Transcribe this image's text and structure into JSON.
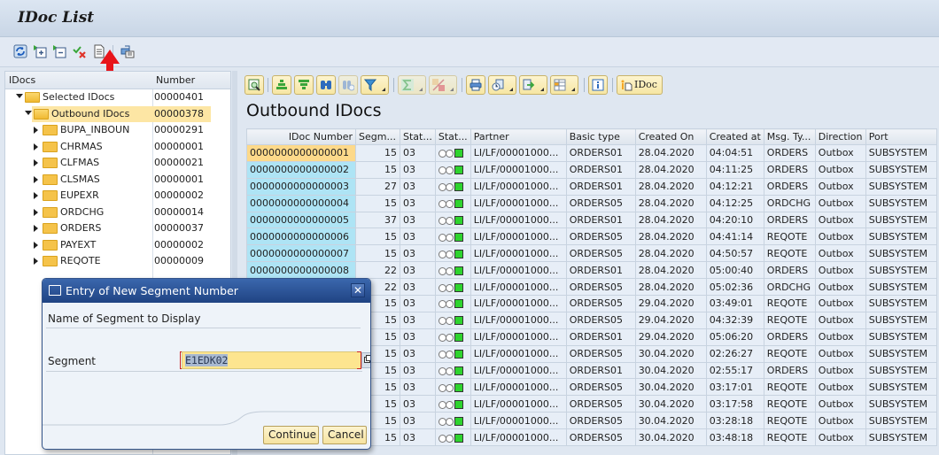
{
  "window": {
    "title": "IDoc List"
  },
  "app_toolbar": {
    "icons": [
      "refresh-icon",
      "expand-subtree-icon",
      "collapse-subtree-icon",
      "check-cancel-icon",
      "document-icon",
      "transport-icon"
    ]
  },
  "annotation": {
    "arrow_color": "#e8141a",
    "points_to": "document-icon"
  },
  "tree": {
    "columns": [
      "IDocs",
      "Number"
    ],
    "nodes": [
      {
        "label": "Selected IDocs",
        "number": "00000401",
        "level": 0,
        "expanded": true
      },
      {
        "label": "Outbound IDocs",
        "number": "00000378",
        "level": 1,
        "expanded": true,
        "selected": true
      },
      {
        "label": "BUPA_INBOUN",
        "number": "00000291",
        "level": 2
      },
      {
        "label": "CHRMAS",
        "number": "00000001",
        "level": 2
      },
      {
        "label": "CLFMAS",
        "number": "00000021",
        "level": 2
      },
      {
        "label": "CLSMAS",
        "number": "00000001",
        "level": 2
      },
      {
        "label": "EUPEXR",
        "number": "00000002",
        "level": 2
      },
      {
        "label": "ORDCHG",
        "number": "00000014",
        "level": 2
      },
      {
        "label": "ORDERS",
        "number": "00000037",
        "level": 2
      },
      {
        "label": "PAYEXT",
        "number": "00000002",
        "level": 2
      },
      {
        "label": "REQOTE",
        "number": "00000009",
        "level": 2
      }
    ]
  },
  "alv_toolbar": {
    "idoc_button_label": "IDoc",
    "buttons": [
      "details-icon",
      "sort-ascending-icon",
      "sort-descending-icon",
      "find-icon",
      "find-next-icon",
      "filter-icon",
      "sum-icon",
      "subtotal-icon",
      "print-icon",
      "views-icon",
      "export-icon",
      "layout-icon",
      "info-icon",
      "idoc-icon"
    ]
  },
  "grid": {
    "title": "Outbound IDocs",
    "columns": [
      "IDoc Number",
      "Segm...",
      "Stat...",
      "Stat...",
      "Partner",
      "Basic type",
      "Created On",
      "Created at",
      "Msg. Ty...",
      "Direction",
      "Port"
    ],
    "rows": [
      [
        "0000000000000001",
        "15",
        "03",
        "green",
        "LI/LF/00001000...",
        "ORDERS01",
        "28.04.2020",
        "04:04:51",
        "ORDERS",
        "Outbox",
        "SUBSYSTEM"
      ],
      [
        "0000000000000002",
        "15",
        "03",
        "green",
        "LI/LF/00001000...",
        "ORDERS01",
        "28.04.2020",
        "04:11:25",
        "ORDERS",
        "Outbox",
        "SUBSYSTEM"
      ],
      [
        "0000000000000003",
        "27",
        "03",
        "green",
        "LI/LF/00001000...",
        "ORDERS01",
        "28.04.2020",
        "04:12:21",
        "ORDERS",
        "Outbox",
        "SUBSYSTEM"
      ],
      [
        "0000000000000004",
        "15",
        "03",
        "green",
        "LI/LF/00001000...",
        "ORDERS05",
        "28.04.2020",
        "04:12:25",
        "ORDCHG",
        "Outbox",
        "SUBSYSTEM"
      ],
      [
        "0000000000000005",
        "37",
        "03",
        "green",
        "LI/LF/00001000...",
        "ORDERS01",
        "28.04.2020",
        "04:20:10",
        "ORDERS",
        "Outbox",
        "SUBSYSTEM"
      ],
      [
        "0000000000000006",
        "15",
        "03",
        "green",
        "LI/LF/00001000...",
        "ORDERS05",
        "28.04.2020",
        "04:41:14",
        "REQOTE",
        "Outbox",
        "SUBSYSTEM"
      ],
      [
        "0000000000000007",
        "15",
        "03",
        "green",
        "LI/LF/00001000...",
        "ORDERS05",
        "28.04.2020",
        "04:50:57",
        "REQOTE",
        "Outbox",
        "SUBSYSTEM"
      ],
      [
        "0000000000000008",
        "22",
        "03",
        "green",
        "LI/LF/00001000...",
        "ORDERS01",
        "28.04.2020",
        "05:00:40",
        "ORDERS",
        "Outbox",
        "SUBSYSTEM"
      ],
      [
        "",
        "22",
        "03",
        "green",
        "LI/LF/00001000...",
        "ORDERS05",
        "28.04.2020",
        "05:02:36",
        "ORDCHG",
        "Outbox",
        "SUBSYSTEM"
      ],
      [
        "",
        "15",
        "03",
        "green",
        "LI/LF/00001000...",
        "ORDERS05",
        "29.04.2020",
        "03:49:01",
        "REQOTE",
        "Outbox",
        "SUBSYSTEM"
      ],
      [
        "",
        "15",
        "03",
        "green",
        "LI/LF/00001000...",
        "ORDERS05",
        "29.04.2020",
        "04:32:39",
        "REQOTE",
        "Outbox",
        "SUBSYSTEM"
      ],
      [
        "",
        "15",
        "03",
        "green",
        "LI/LF/00001000...",
        "ORDERS01",
        "29.04.2020",
        "05:06:20",
        "ORDERS",
        "Outbox",
        "SUBSYSTEM"
      ],
      [
        "",
        "15",
        "03",
        "green",
        "LI/LF/00001000...",
        "ORDERS05",
        "30.04.2020",
        "02:26:27",
        "REQOTE",
        "Outbox",
        "SUBSYSTEM"
      ],
      [
        "",
        "15",
        "03",
        "green",
        "LI/LF/00001000...",
        "ORDERS01",
        "30.04.2020",
        "02:55:17",
        "ORDERS",
        "Outbox",
        "SUBSYSTEM"
      ],
      [
        "",
        "15",
        "03",
        "green",
        "LI/LF/00001000...",
        "ORDERS05",
        "30.04.2020",
        "03:17:01",
        "REQOTE",
        "Outbox",
        "SUBSYSTEM"
      ],
      [
        "",
        "15",
        "03",
        "green",
        "LI/LF/00001000...",
        "ORDERS05",
        "30.04.2020",
        "03:17:58",
        "REQOTE",
        "Outbox",
        "SUBSYSTEM"
      ],
      [
        "",
        "15",
        "03",
        "green",
        "LI/LF/00001000...",
        "ORDERS05",
        "30.04.2020",
        "03:28:18",
        "REQOTE",
        "Outbox",
        "SUBSYSTEM"
      ],
      [
        "",
        "15",
        "03",
        "green",
        "LI/LF/00001000...",
        "ORDERS05",
        "30.04.2020",
        "03:48:18",
        "REQOTE",
        "Outbox",
        "SUBSYSTEM"
      ]
    ]
  },
  "dialog": {
    "title": "Entry of New Segment Number",
    "section_label": "Name of Segment to Display",
    "field_label": "Segment",
    "field_value": "E1EDK02",
    "continue_label": "Continue",
    "cancel_label": "Cancel",
    "close_glyph": "✕"
  }
}
